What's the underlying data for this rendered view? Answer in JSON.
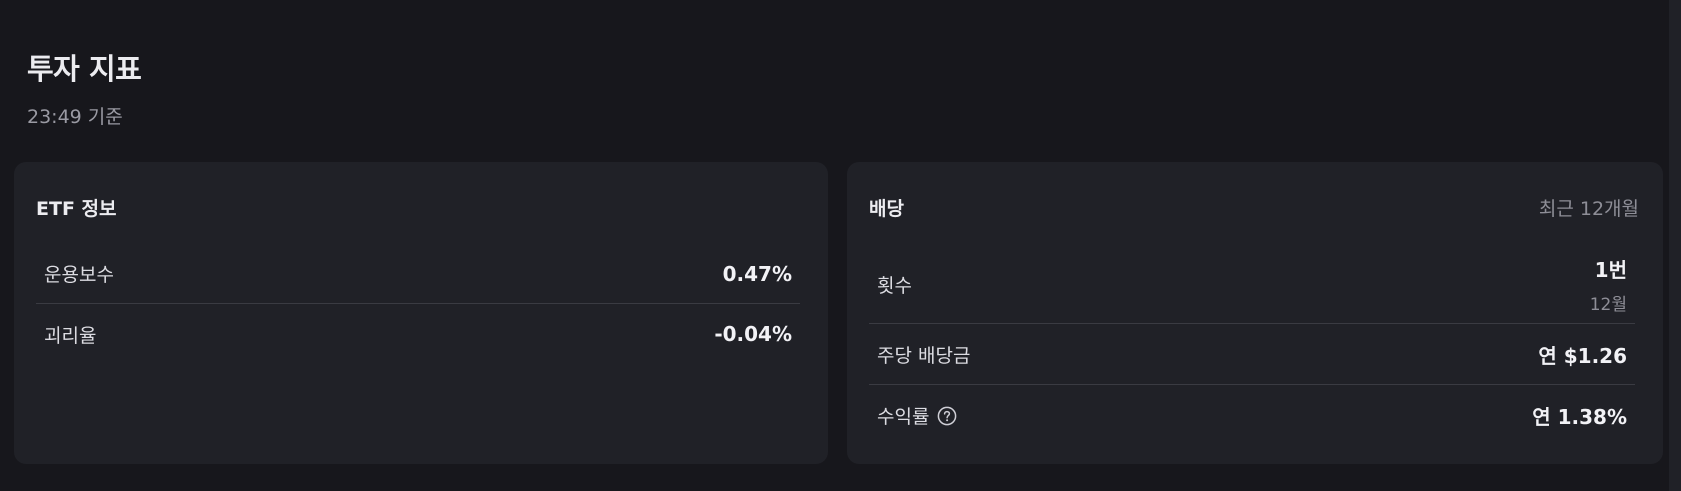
{
  "header": {
    "title": "투자 지표",
    "subtitle": "23:49 기준"
  },
  "etf_info": {
    "title": "ETF 정보",
    "rows": [
      {
        "label": "운용보수",
        "value": "0.47%"
      },
      {
        "label": "괴리율",
        "value": "-0.04%"
      }
    ]
  },
  "dividend": {
    "title": "배당",
    "period": "최근 12개월",
    "rows": [
      {
        "label": "횟수",
        "value": "1번",
        "sub": "12월"
      },
      {
        "label": "주당 배당금",
        "value": "연 $1.26"
      },
      {
        "label": "수익률",
        "value": "연 1.38%",
        "icon": "help-circle-icon"
      }
    ]
  },
  "colors": {
    "background": "#17171c",
    "card": "#202127",
    "divider": "#3a3b42",
    "text_primary": "#f2f2f6",
    "text_secondary": "#8e8e97"
  }
}
